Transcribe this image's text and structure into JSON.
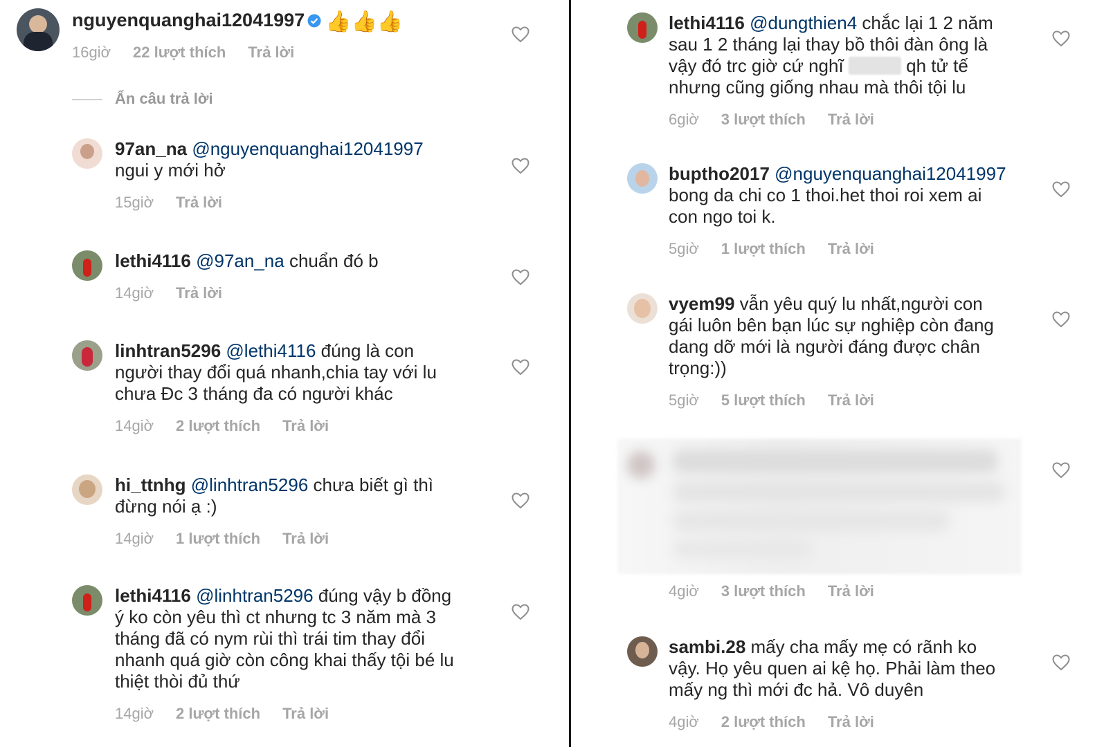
{
  "left": {
    "main_comment": {
      "username": "nguyenquanghai12041997",
      "emojis": "👍👍👍",
      "time": "16giờ",
      "likes": "22 lượt thích",
      "reply": "Trả lời"
    },
    "hide_replies": "Ẩn câu trả lời",
    "replies": [
      {
        "username": "97an_na",
        "mention": "@nguyenquanghai12041997",
        "text_lines": [
          "",
          "ngui y mới hở"
        ],
        "time": "15giờ",
        "likes": "",
        "reply": "Trả lời"
      },
      {
        "username": "lethi4116",
        "mention": "@97an_na",
        "text_lines": [
          " chuẩn đó b"
        ],
        "time": "14giờ",
        "likes": "",
        "reply": "Trả lời"
      },
      {
        "username": "linhtran5296",
        "mention": "@lethi4116",
        "text_lines": [
          " đúng là con",
          "người thay đổi quá nhanh,chia tay với lu",
          "chưa Đc 3 tháng đa có người khác"
        ],
        "time": "14giờ",
        "likes": "2 lượt thích",
        "reply": "Trả lời"
      },
      {
        "username": "hi_ttnhg",
        "mention": "@linhtran5296",
        "text_lines": [
          " chưa biết gì thì",
          "đừng nói ạ :)"
        ],
        "time": "14giờ",
        "likes": "1 lượt thích",
        "reply": "Trả lời"
      },
      {
        "username": "lethi4116",
        "mention": "@linhtran5296",
        "text_lines": [
          " đúng vậy b đồng",
          "ý ko còn yêu thì ct nhưng tc 3 năm mà 3",
          "tháng đã có nym rùi thì trái tim thay đổi",
          "nhanh quá giờ còn công khai thấy tội bé lu",
          "thiệt thòi đủ thứ"
        ],
        "time": "14giờ",
        "likes": "2 lượt thích",
        "reply": "Trả lời"
      }
    ]
  },
  "right": {
    "replies": [
      {
        "username": "lethi4116",
        "mention": "@dungthien4",
        "text_lines": [
          " chắc lại 1 2 năm",
          "sau 1 2 tháng lại thay bồ thôi đàn ông là",
          "vậy đó trc giờ cứ nghĩ ",
          "nhưng cũng giống nhau mà thôi tội lu"
        ],
        "redacted_tail": " qh tử tế",
        "time": "6giờ",
        "likes": "3 lượt thích",
        "reply": "Trả lời"
      },
      {
        "username": "buptho2017",
        "mention": "@nguyenquanghai12041997",
        "text_lines": [
          "",
          "bong da chi co 1 thoi.het thoi roi xem ai",
          "con ngo toi k."
        ],
        "time": "5giờ",
        "likes": "1 lượt thích",
        "reply": "Trả lời"
      },
      {
        "username": "vyem99",
        "mention": "",
        "text_lines": [
          " vẫn yêu quý lu nhất,người con",
          "gái luôn bên bạn lúc sự nghiệp còn đang",
          "dang dỡ mới là người đáng được chân",
          "trọng:))"
        ],
        "time": "5giờ",
        "likes": "5 lượt thích",
        "reply": "Trả lời"
      },
      {
        "username": "",
        "mention": "",
        "text_lines": [],
        "time": "4giờ",
        "likes": "3 lượt thích",
        "reply": "Trả lời"
      },
      {
        "username": "sambi.28",
        "mention": "",
        "text_lines": [
          " mấy cha mấy mẹ có rãnh ko",
          "vậy. Họ yêu  quen ai kệ họ. Phải làm theo",
          "mấy ng thì mới đc hả. Vô duyên"
        ],
        "time": "4giờ",
        "likes": "2 lượt thích",
        "reply": "Trả lời"
      }
    ]
  },
  "colors": {
    "mention": "#003569",
    "meta": "#a6a6a6",
    "text": "#262626",
    "verified": "#3897f0"
  }
}
